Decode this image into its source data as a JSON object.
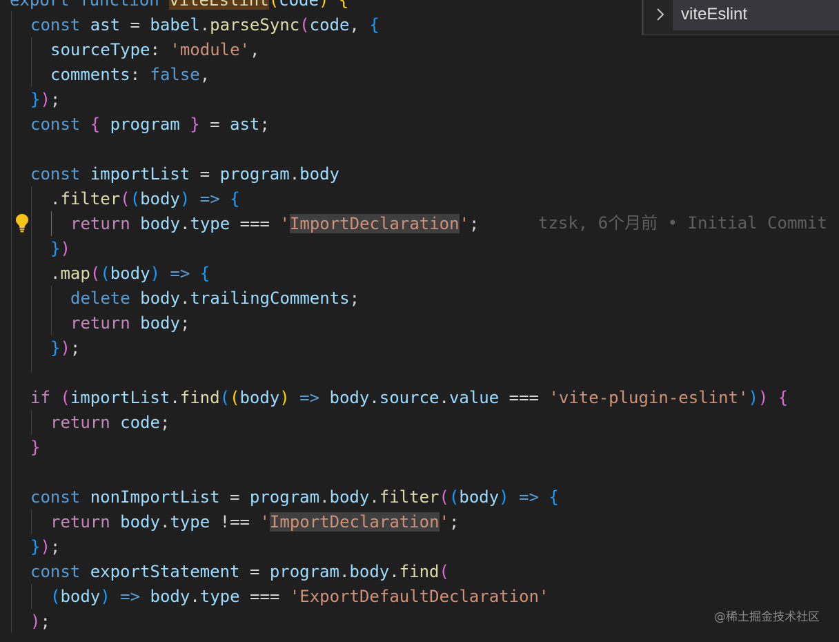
{
  "editor": {
    "lines": {
      "l0": {
        "t1": "export",
        "t2": "function",
        "t3": "viteEslint",
        "t4": "(",
        "t5": "code",
        "t6": ")",
        "t7": "{"
      },
      "l1": {
        "t1": "const",
        "t2": "ast",
        "t3": "=",
        "t4": "babel",
        "t5": ".",
        "t6": "parseSync",
        "t7": "(",
        "t8": "code",
        "t9": ",",
        "t10": "{"
      },
      "l2": {
        "t1": "sourceType",
        "t2": ":",
        "t3": "'module'",
        "t4": ","
      },
      "l3": {
        "t1": "comments",
        "t2": ":",
        "t3": "false",
        "t4": ","
      },
      "l4": {
        "t1": "}",
        "t2": ")",
        "t3": ";"
      },
      "l5": {
        "t1": "const",
        "t2": "{",
        "t3": "program",
        "t4": "}",
        "t5": "=",
        "t6": "ast",
        "t7": ";"
      },
      "l7": {
        "t1": "const",
        "t2": "importList",
        "t3": "=",
        "t4": "program",
        "t5": ".",
        "t6": "body"
      },
      "l8": {
        "t1": ".",
        "t2": "filter",
        "t3": "(",
        "t4": "(",
        "t5": "body",
        "t6": ")",
        "t7": "=>",
        "t8": "{"
      },
      "l9": {
        "t1": "return",
        "t2": "body",
        "t3": ".",
        "t4": "type",
        "t5": "===",
        "t6": "'",
        "t7": "ImportDeclaration",
        "t8": "'",
        "t9": ";"
      },
      "l10": {
        "t1": "}",
        "t2": ")"
      },
      "l11": {
        "t1": ".",
        "t2": "map",
        "t3": "(",
        "t4": "(",
        "t5": "body",
        "t6": ")",
        "t7": "=>",
        "t8": "{"
      },
      "l12": {
        "t1": "delete",
        "t2": "body",
        "t3": ".",
        "t4": "trailingComments",
        "t5": ";"
      },
      "l13": {
        "t1": "return",
        "t2": "body",
        "t3": ";"
      },
      "l14": {
        "t1": "}",
        "t2": ")",
        "t3": ";"
      },
      "l16": {
        "t1": "if",
        "t2": "(",
        "t3": "importList",
        "t4": ".",
        "t5": "find",
        "t6": "(",
        "t7": "(",
        "t8": "body",
        "t9": ")",
        "t10": "=>",
        "t11": "body",
        "t12": ".",
        "t13": "source",
        "t14": ".",
        "t15": "value",
        "t16": "===",
        "t17": "'vite-plugin-eslint'",
        "t18": ")",
        "t19": ")",
        "t20": "{"
      },
      "l17": {
        "t1": "return",
        "t2": "code",
        "t3": ";"
      },
      "l18": {
        "t1": "}"
      },
      "l20": {
        "t1": "const",
        "t2": "nonImportList",
        "t3": "=",
        "t4": "program",
        "t5": ".",
        "t6": "body",
        "t7": ".",
        "t8": "filter",
        "t9": "(",
        "t10": "(",
        "t11": "body",
        "t12": ")",
        "t13": "=>",
        "t14": "{"
      },
      "l21": {
        "t1": "return",
        "t2": "body",
        "t3": ".",
        "t4": "type",
        "t5": "!==",
        "t6": "'",
        "t7": "ImportDeclaration",
        "t8": "'",
        "t9": ";"
      },
      "l22": {
        "t1": "}",
        "t2": ")",
        "t3": ";"
      },
      "l23": {
        "t1": "const",
        "t2": "exportStatement",
        "t3": "=",
        "t4": "program",
        "t5": ".",
        "t6": "body",
        "t7": ".",
        "t8": "find",
        "t9": "("
      },
      "l24": {
        "t1": "(",
        "t2": "body",
        "t3": ")",
        "t4": "=>",
        "t5": "body",
        "t6": ".",
        "t7": "type",
        "t8": "===",
        "t9": "'ExportDefaultDeclaration'"
      },
      "l25": {
        "t1": ")",
        "t2": ";"
      }
    }
  },
  "blame": {
    "text": "tzsk, 6个月前 • Initial Commit"
  },
  "breadcrumb": {
    "label": "viteEslint"
  },
  "icons": {
    "lightbulb": "lightbulb-icon",
    "chevron": "chevron-right-icon"
  },
  "watermark": {
    "text": "@稀土掘金技术社区"
  },
  "colors": {
    "background": "#1f1f1f",
    "keyword": "#569cd6",
    "string": "#ce9178",
    "function": "#dcdcaa",
    "variable": "#9cdcfe",
    "control": "#c586c0"
  }
}
